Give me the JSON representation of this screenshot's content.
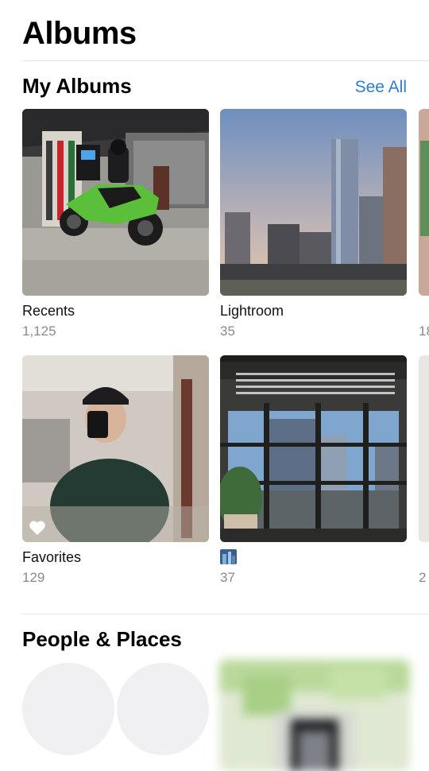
{
  "header": {
    "title": "Albums"
  },
  "my_albums": {
    "title": "My Albums",
    "see_all": "See All",
    "albums": [
      {
        "name": "Recents",
        "count": "1,125"
      },
      {
        "name": "Lightroom",
        "count": "35"
      },
      {
        "name": "Favorites",
        "count": "129"
      },
      {
        "name": "",
        "count": "37",
        "name_icon": "album-cover-icon"
      }
    ],
    "partial_counts": [
      "18",
      "2"
    ]
  },
  "people_places": {
    "title": "People & Places"
  },
  "colors": {
    "accent": "#2f7ad6",
    "secondary_text": "#8a8a8e",
    "divider": "#e3e3e6"
  }
}
